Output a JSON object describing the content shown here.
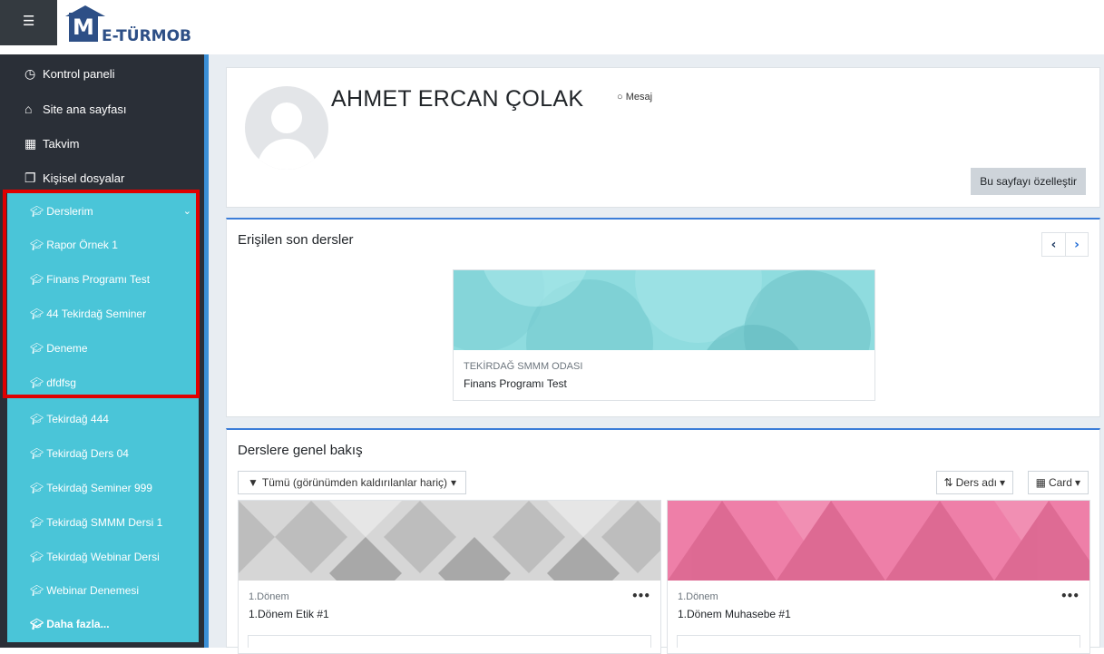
{
  "brand": {
    "logo_letter": "M",
    "logo_text": "E-TÜRMOB"
  },
  "nav": {
    "menu_icon": "hamburger-icon",
    "items": [
      {
        "label": "Kontrol paneli",
        "icon": "dashboard-icon"
      },
      {
        "label": "Site ana sayfası",
        "icon": "home-icon"
      },
      {
        "label": "Takvim",
        "icon": "calendar-icon"
      },
      {
        "label": "Kişisel dosyalar",
        "icon": "files-icon"
      }
    ]
  },
  "courses": {
    "header": "Derslerim",
    "items": [
      "Rapor Örnek 1",
      "Finans Programı Test",
      "44 Tekirdağ Seminer",
      "Deneme",
      "dfdfsg",
      "Tekirdağ 444",
      "Tekirdağ Ders 04",
      "Tekirdağ Seminer 999",
      "Tekirdağ SMMM Dersi 1",
      "Tekirdağ Webinar Dersi",
      "Webinar Denemesi"
    ],
    "more": "Daha fazla..."
  },
  "profile": {
    "name": "AHMET ERCAN ÇOLAK",
    "message_label": "Mesaj",
    "customize_button": "Bu sayfayı özelleştir"
  },
  "recent": {
    "title": "Erişilen son dersler",
    "course": {
      "category": "TEKİRDAĞ SMMM ODASI",
      "name": "Finans Programı Test"
    }
  },
  "overview": {
    "title": "Derslere genel bakış",
    "filter_label": "Tümü (görünümden kaldırılanlar hariç)",
    "sort_label": "Ders adı",
    "view_label": "Card",
    "cards": [
      {
        "category": "1.Dönem",
        "name": "1.Dönem Etik #1"
      },
      {
        "category": "1.Dönem",
        "name": "1.Dönem Muhasebe #1"
      }
    ]
  },
  "colors": {
    "sidebar": "#2a2f37",
    "course_highlight": "#4ac5d8",
    "frame": "#e00000",
    "accent": "#3b7dd8"
  }
}
